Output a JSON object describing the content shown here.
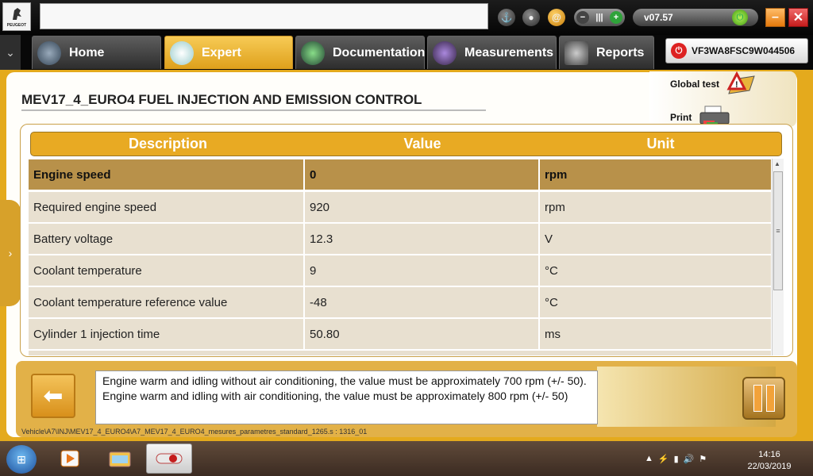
{
  "topbar": {
    "brand": "PEUGEOT",
    "search_value": "",
    "version": "v07.57",
    "minimize": "–",
    "close": "✕"
  },
  "nav": {
    "tabs": [
      {
        "label": "Home",
        "icon": "home-icon"
      },
      {
        "label": "Expert",
        "icon": "magnifier-icon"
      },
      {
        "label": "Documentation",
        "icon": "book-icon"
      },
      {
        "label": "Measurements",
        "icon": "wave-icon"
      },
      {
        "label": "Reports",
        "icon": "report-icon"
      }
    ],
    "active_tab": "Expert",
    "vin": "VF3WA8FSC9W044506"
  },
  "page": {
    "title": "MEV17_4_EURO4  FUEL INJECTION AND EMISSION CONTROL",
    "actions": {
      "global_test": "Global test",
      "print": "Print"
    }
  },
  "table": {
    "headers": [
      "Description",
      "Value",
      "Unit"
    ],
    "rows": [
      {
        "description": "Engine speed",
        "value": "0",
        "unit": "rpm",
        "selected": true
      },
      {
        "description": "Required engine speed",
        "value": "920",
        "unit": "rpm"
      },
      {
        "description": "Battery voltage",
        "value": "12.3",
        "unit": "V"
      },
      {
        "description": "Coolant temperature",
        "value": "9",
        "unit": "°C"
      },
      {
        "description": "Coolant temperature reference value",
        "value": "-48",
        "unit": "°C"
      },
      {
        "description": "Cylinder 1 injection time",
        "value": "50.80",
        "unit": "ms"
      }
    ]
  },
  "bottom": {
    "message": "Engine warm and idling without air conditioning, the value must be approximately 700 rpm (+/- 50). Engine warm and idling with air conditioning, the value must be approximately 800 rpm (+/- 50)",
    "path": "Vehicle\\A7\\INJ\\MEV17_4_EURO4\\A7_MEV17_4_EURO4_mesures_parametres_standard_1265.s : 1316_01"
  },
  "taskbar": {
    "time": "14:16",
    "date": "22/03/2019"
  },
  "colors": {
    "accent": "#e8aa23",
    "selected_row": "#b8914a",
    "row": "#e8e0d0"
  }
}
